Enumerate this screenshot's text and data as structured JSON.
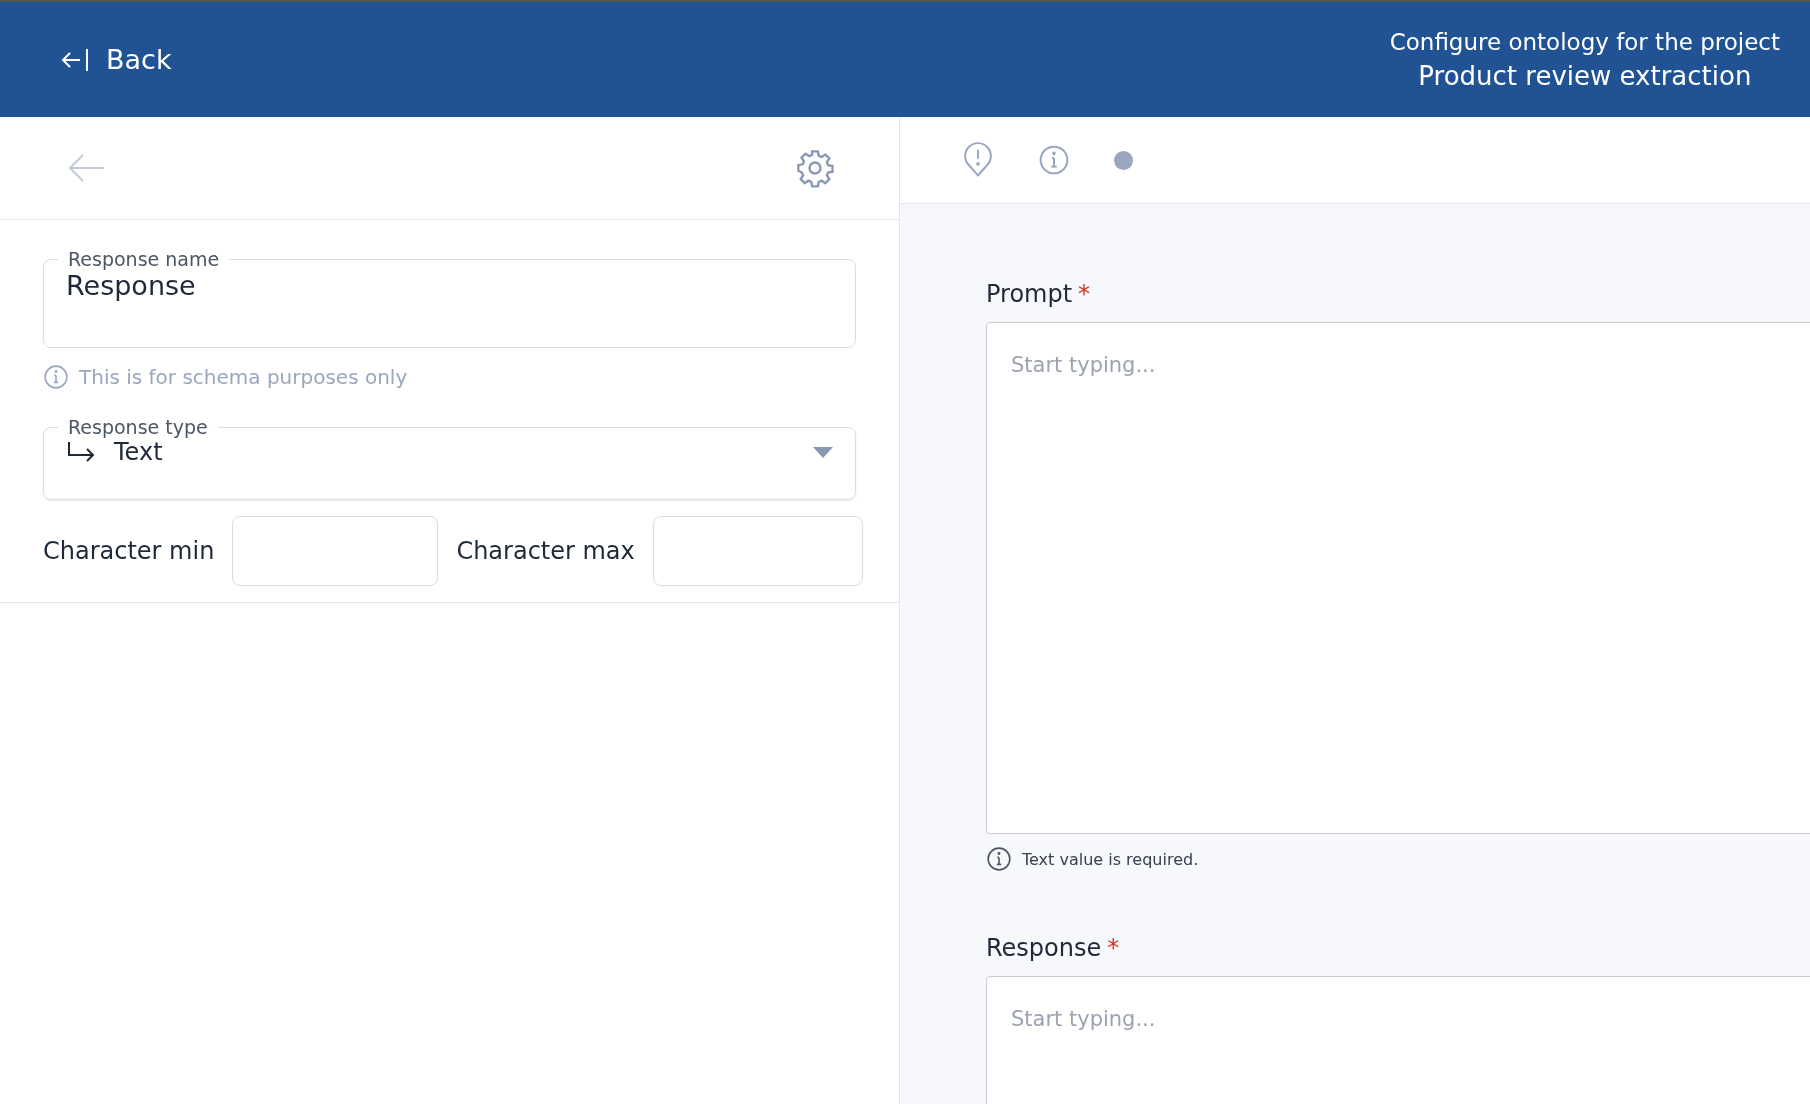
{
  "header": {
    "back_label": "Back",
    "subtitle": "Configure ontology for the project",
    "project_name": "Product review extraction"
  },
  "editor": {
    "name_field": {
      "label": "Response name",
      "value": "Response",
      "hint": "This is for schema purposes only"
    },
    "type_field": {
      "label": "Response type",
      "value": "Text"
    },
    "limits": [
      {
        "label": "Character min"
      },
      {
        "label": "Character max"
      }
    ]
  },
  "preview": {
    "fields": [
      {
        "label": "Prompt",
        "required": true,
        "required_mark": "*",
        "placeholder": "Start typing...",
        "error": "Text value is required."
      },
      {
        "label": "Response",
        "required": true,
        "required_mark": "*",
        "placeholder": "Start typing..."
      }
    ]
  }
}
